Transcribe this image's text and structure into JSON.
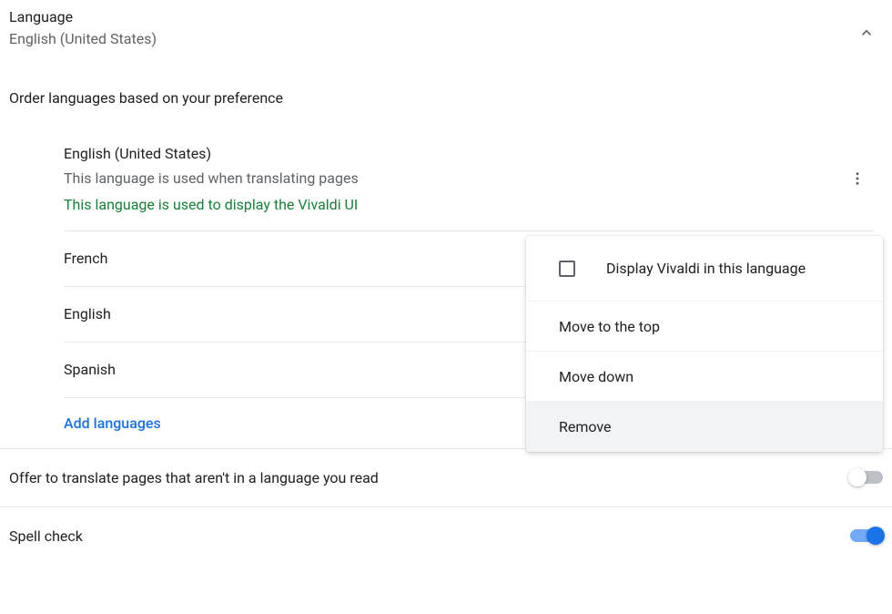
{
  "header": {
    "title": "Language",
    "subtitle": "English (United States)"
  },
  "order_label": "Order languages based on your preference",
  "languages": {
    "primary": {
      "name": "English (United States)",
      "translate_note": "This language is used when translating pages",
      "ui_note": "This language is used to display the Vivaldi UI"
    },
    "items": [
      {
        "name": "French"
      },
      {
        "name": "English"
      },
      {
        "name": "Spanish"
      }
    ]
  },
  "add_languages_label": "Add languages",
  "settings": {
    "translate_offer": "Offer to translate pages that aren't in a language you read",
    "spell_check": "Spell check"
  },
  "menu": {
    "display_in_lang": "Display Vivaldi in this language",
    "move_top": "Move to the top",
    "move_down": "Move down",
    "remove": "Remove"
  }
}
